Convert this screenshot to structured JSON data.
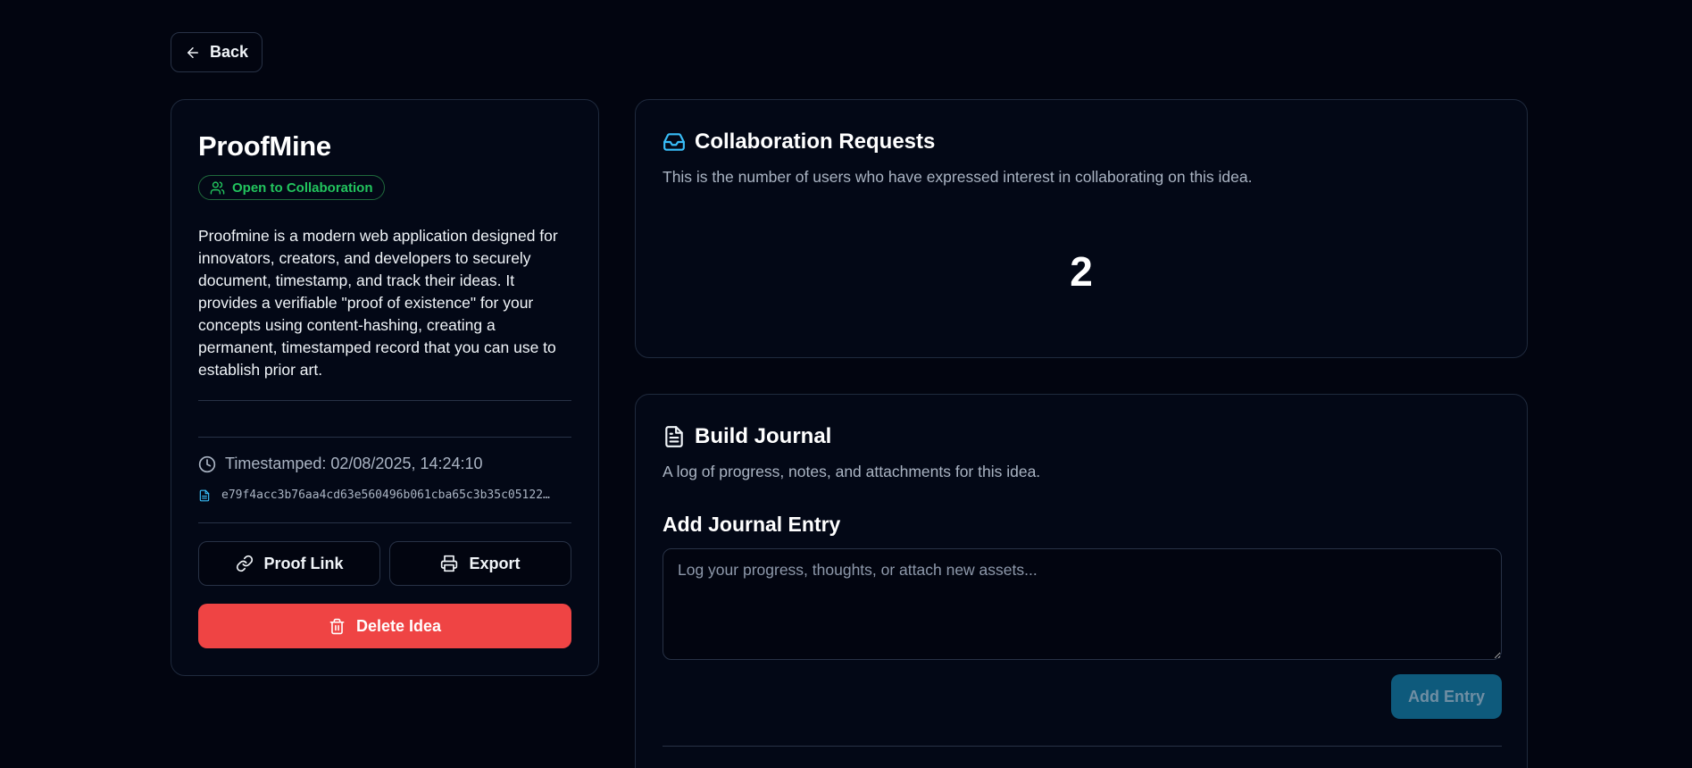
{
  "nav": {
    "back_label": "Back",
    "back_icon": "arrow-left-icon"
  },
  "idea": {
    "title": "ProofMine",
    "status_badge": "Open to Collaboration",
    "status_color": "#22c55e",
    "description": "Proofmine is a modern web application designed for innovators, creators, and developers to securely document, timestamp, and track their ideas. It provides a verifiable \"proof of existence\" for your concepts using content-hashing, creating a permanent, timestamped record that you can use to establish prior art.",
    "timestamp_label": "Timestamped: 02/08/2025, 14:24:10",
    "hash": "e79f4acc3b76aa4cd63e560496b061cba65c3b35c05122…",
    "actions": {
      "proof_link_label": "Proof Link",
      "export_label": "Export",
      "delete_label": "Delete Idea"
    },
    "delete_color": "#ef4444"
  },
  "collaboration": {
    "title": "Collaboration Requests",
    "subtitle": "This is the number of users who have expressed interest in collaborating on this idea.",
    "count": "2",
    "icon": "inbox-icon",
    "accent": "#38bdf8"
  },
  "journal": {
    "title": "Build Journal",
    "subtitle": "A log of progress, notes, and attachments for this idea.",
    "entry_label": "Add Journal Entry",
    "entry_placeholder": "Log your progress, thoughts, or attach new assets...",
    "entry_value": "",
    "add_button_label": "Add Entry",
    "add_button_color": "#0e5a7c"
  }
}
